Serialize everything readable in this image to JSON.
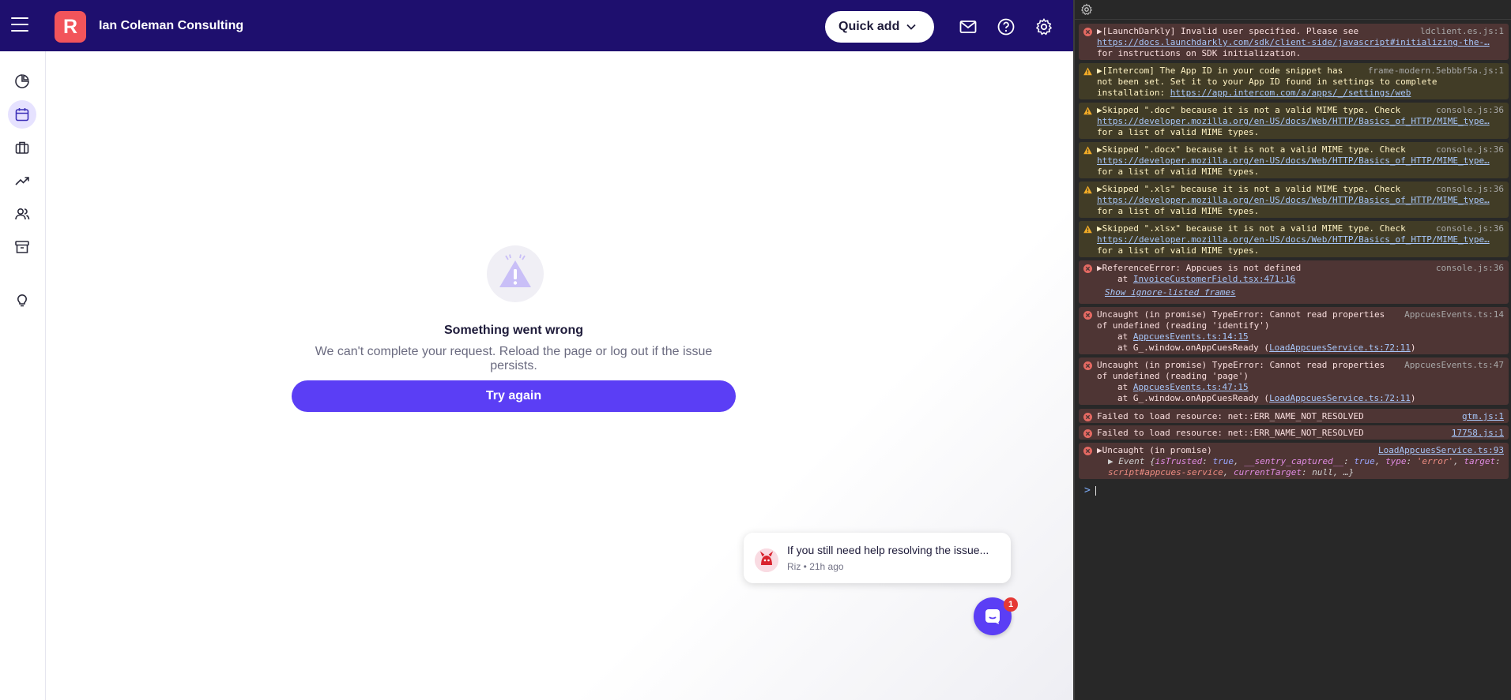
{
  "app": {
    "org_name": "Ian Coleman Consulting",
    "logo_letter": "R",
    "quick_add_label": "Quick add",
    "brand_color": "#1e0f6e",
    "accent_color": "#5b3ef5"
  },
  "sidebar": {
    "items": [
      {
        "icon": "pie-chart-icon"
      },
      {
        "icon": "calendar-icon",
        "active": true
      },
      {
        "icon": "briefcase-icon"
      },
      {
        "icon": "trending-up-icon"
      },
      {
        "icon": "users-icon"
      },
      {
        "icon": "archive-icon"
      },
      {
        "icon": "lightbulb-icon"
      }
    ]
  },
  "error": {
    "title": "Something went wrong",
    "description": "We can't complete your request. Reload the page or log out if the issue persists.",
    "button_label": "Try again"
  },
  "chat": {
    "message": "If you still need help resolving the issue...",
    "meta": "Riz • 21h ago",
    "badge_count": "1"
  },
  "console": {
    "messages": [
      {
        "level": "error",
        "text": "▶[LaunchDarkly] Invalid user specified. Please see",
        "link": "https://docs.launchdarkly.com/sdk/client-side/javascript#initializing-the-…",
        "tail": "for instructions on SDK initialization.",
        "source": "ldclient.es.js:1"
      },
      {
        "level": "warning",
        "text": "▶[Intercom] The App ID in your code snippet has",
        "text2": "not been set. Set it to your App ID found in settings to complete",
        "text3": "installation:",
        "link": "https://app.intercom.com/a/apps/_/settings/web",
        "source": "frame-modern.5ebbbf5a.js:1"
      },
      {
        "level": "warning",
        "text": "▶Skipped \".doc\" because it is not a valid MIME type. Check",
        "link": "https://developer.mozilla.org/en-US/docs/Web/HTTP/Basics_of_HTTP/MIME_type…",
        "tail": "for a list of valid MIME types.",
        "source": "console.js:36"
      },
      {
        "level": "warning",
        "text": "▶Skipped \".docx\" because it is not a valid MIME type. Check",
        "link": "https://developer.mozilla.org/en-US/docs/Web/HTTP/Basics_of_HTTP/MIME_type…",
        "tail": "for a list of valid MIME types.",
        "source": "console.js:36"
      },
      {
        "level": "warning",
        "text": "▶Skipped \".xls\" because it is not a valid MIME type. Check",
        "link": "https://developer.mozilla.org/en-US/docs/Web/HTTP/Basics_of_HTTP/MIME_type…",
        "tail": "for a list of valid MIME types.",
        "source": "console.js:36"
      },
      {
        "level": "warning",
        "text": "▶Skipped \".xlsx\" because it is not a valid MIME type. Check",
        "link": "https://developer.mozilla.org/en-US/docs/Web/HTTP/Basics_of_HTTP/MIME_type…",
        "tail": "for a list of valid MIME types.",
        "source": "console.js:36"
      },
      {
        "level": "error",
        "text": "▶ReferenceError: Appcues is not defined",
        "at_prefix": "at",
        "at_link": "InvoiceCustomerField.tsx:471:16",
        "ignore": "Show ignore-listed frames",
        "source": "console.js:36"
      },
      {
        "level": "error",
        "text": "Uncaught (in promise) TypeError: Cannot read properties",
        "text2": "of undefined (reading 'identify')",
        "at1_prefix": "at",
        "at1_link": "AppcuesEvents.ts:14:15",
        "at2_prefix": "at G_.window.onAppCuesReady (",
        "at2_link": "LoadAppcuesService.ts:72:11",
        "at2_suffix": ")",
        "source": "AppcuesEvents.ts:14"
      },
      {
        "level": "error",
        "text": "Uncaught (in promise) TypeError: Cannot read properties",
        "text2": "of undefined (reading 'page')",
        "at1_prefix": "at",
        "at1_link": "AppcuesEvents.ts:47:15",
        "at2_prefix": "at G_.window.onAppCuesReady (",
        "at2_link": "LoadAppcuesService.ts:72:11",
        "at2_suffix": ")",
        "source": "AppcuesEvents.ts:47"
      },
      {
        "level": "error",
        "text": "Failed to load resource: net::ERR_NAME_NOT_RESOLVED",
        "source": "gtm.js:1"
      },
      {
        "level": "error",
        "text": "Failed to load resource: net::ERR_NAME_NOT_RESOLVED",
        "source": "17758.js:1"
      },
      {
        "level": "error",
        "text": "▶Uncaught (in promise)",
        "event_prefix": "▶ Event {",
        "event_k1": "isTrusted",
        "event_v1": "true",
        "event_k2": "__sentry_captured__",
        "event_v2": "true",
        "event_k3": "type",
        "event_v3": "'error'",
        "event_k4": "target",
        "event_v4": "script#appcues-service",
        "event_k5": "currentTarget",
        "event_v5": "null",
        "event_end": "…}",
        "source": "LoadAppcuesService.ts:93"
      }
    ],
    "prompt": ">"
  }
}
